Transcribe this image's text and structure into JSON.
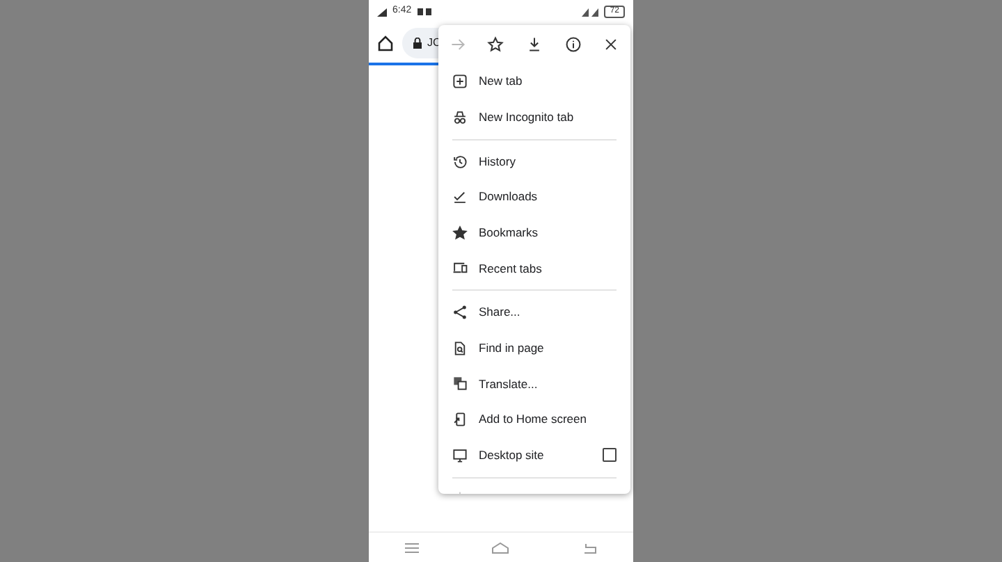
{
  "status_bar": {
    "time": "6:42",
    "battery": "72"
  },
  "toolbar": {
    "address": "JC"
  },
  "menu": {
    "actions": [
      {
        "disabled": true
      },
      {
        "disabled": false
      },
      {
        "disabled": false
      },
      {
        "disabled": false
      },
      {
        "disabled": false
      }
    ],
    "items": [
      {
        "kind": "item",
        "label": "New tab"
      },
      {
        "kind": "item",
        "label": "New Incognito tab"
      },
      {
        "kind": "divider"
      },
      {
        "kind": "item",
        "label": "History"
      },
      {
        "kind": "item",
        "label": "Downloads"
      },
      {
        "kind": "item",
        "label": "Bookmarks"
      },
      {
        "kind": "item",
        "label": "Recent tabs"
      },
      {
        "kind": "divider"
      },
      {
        "kind": "item",
        "label": "Share..."
      },
      {
        "kind": "item",
        "label": "Find in page"
      },
      {
        "kind": "item",
        "label": "Translate..."
      },
      {
        "kind": "item",
        "label": "Add to Home screen"
      },
      {
        "kind": "check",
        "label": "Desktop site",
        "checked": false
      },
      {
        "kind": "divider"
      },
      {
        "kind": "faded"
      }
    ]
  }
}
